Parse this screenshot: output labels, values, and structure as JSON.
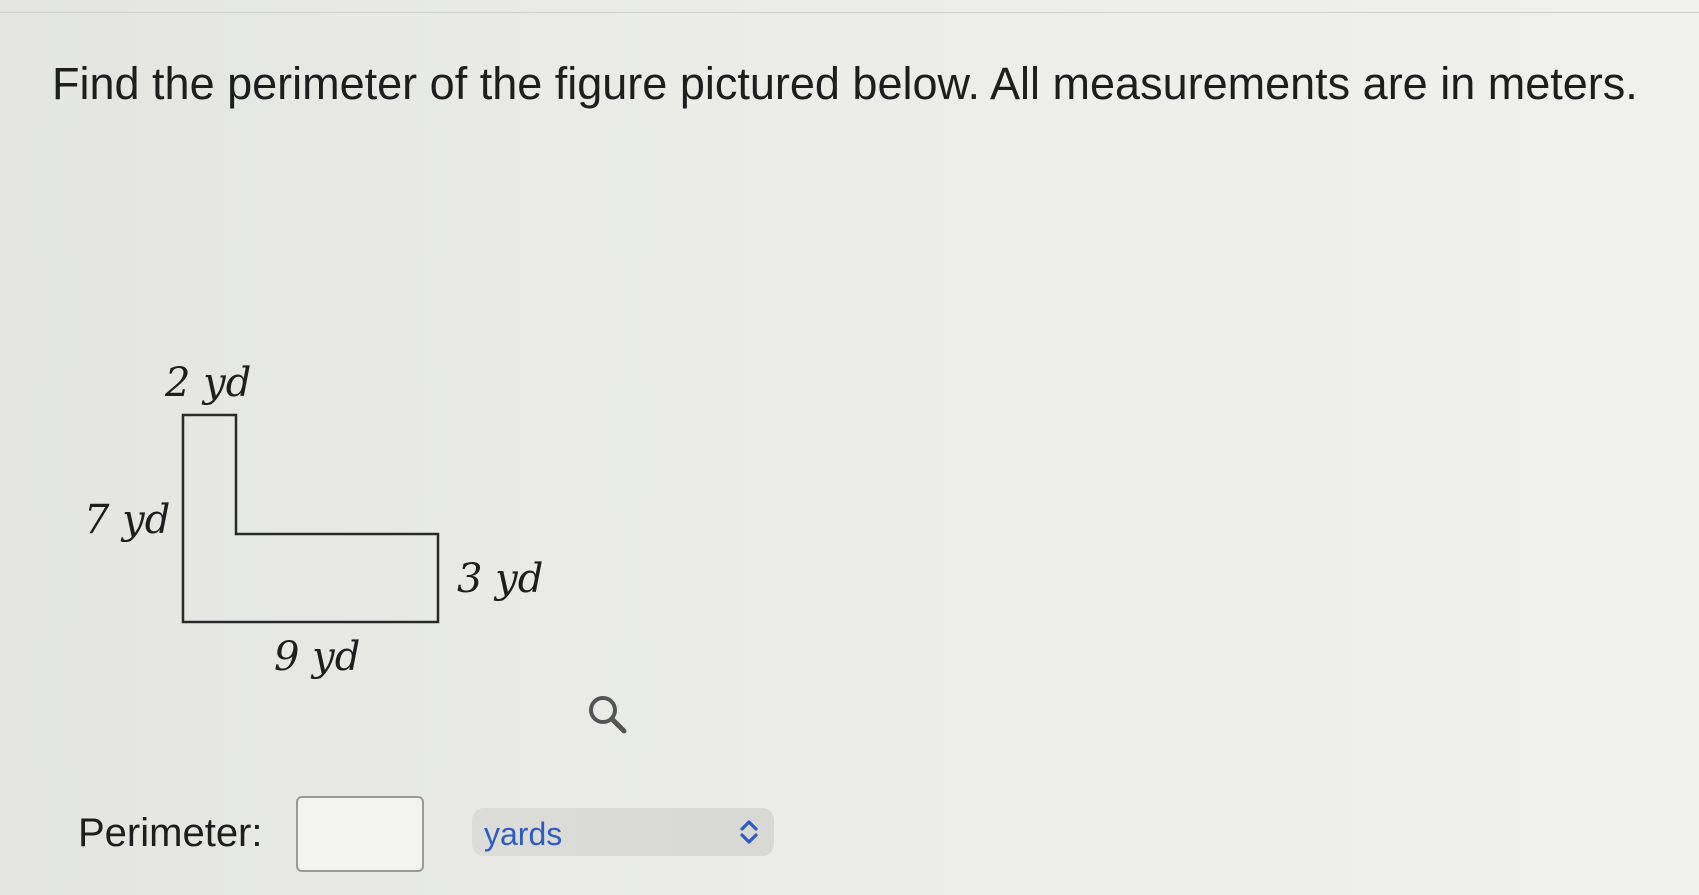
{
  "question": {
    "text": "Find the perimeter of the figure pictured below. All measurements are in meters."
  },
  "figure": {
    "labels": {
      "top": "2 yd",
      "left": "7 yd",
      "right": "3 yd",
      "bottom": "9 yd"
    }
  },
  "zoom": {
    "icon": "magnifier-icon"
  },
  "answer": {
    "label": "Perimeter:",
    "value": "",
    "unit": "yards",
    "unit_icon": "up-down-chevron-icon"
  },
  "colors": {
    "unit_text": "#2f5cc4",
    "figure_stroke": "#2a2a2a"
  }
}
